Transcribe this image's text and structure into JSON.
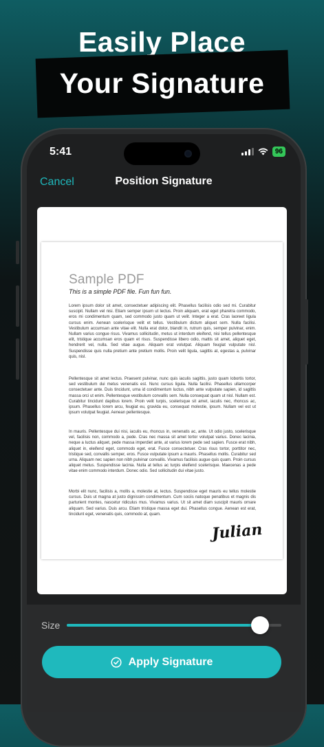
{
  "headline": {
    "line1": "Easily Place",
    "line2": "Your Signature"
  },
  "status_bar": {
    "time": "5:41",
    "battery": "96"
  },
  "nav": {
    "cancel_label": "Cancel",
    "title": "Position Signature"
  },
  "document": {
    "title": "Sample PDF",
    "subtitle": "This is a simple PDF file. Fun fun fun.",
    "paragraphs": [
      "Lorem ipsum dolor sit amet, consectetuer adipiscing elit. Phasellus facilisis odio sed mi. Curabitur suscipit. Nullam vel nisi. Etiam semper ipsum ut lectus. Proin aliquam, erat eget pharetra commodo, eros mi condimentum quam, sed commodo justo quam ut velit. Integer a erat. Cras laoreet ligula cursus enim. Aenean scelerisque velit et tellus. Vestibulum dictum aliquet sem. Nulla facilisi. Vestibulum accumsan ante vitae elit. Nulla erat dolor, blandit in, rutrum quis, semper pulvinar, enim. Nullam varius congue risus. Vivamus sollicitudin, metus ut interdum eleifend, nisi tellus pellentesque elit, tristique accumsan eros quam et risus. Suspendisse libero odio, mattis sit amet, aliquet eget, hendrerit vel, nulla. Sed vitae augue. Aliquam erat volutpat. Aliquam feugiat vulputate nisl. Suspendisse quis nulla pretium ante pretium mollis. Proin velit ligula, sagittis at, egestas a, pulvinar quis, nisl.",
      "Pellentesque sit amet lectus. Praesent pulvinar, nunc quis iaculis sagittis, justo quam lobortis tortor, sed vestibulum dui metus venenatis est. Nunc cursus ligula. Nulla facilisi. Phasellus ullamcorper consectetuer ante. Duis tincidunt, urna id condimentum luctus, nibh ante vulputate sapien, id sagittis massa orci ut enim. Pellentesque vestibulum convallis sem. Nulla consequat quam ut nisl. Nullam est. Curabitur tincidunt dapibus lorem. Proin velit turpis, scelerisque sit amet, iaculis nec, rhoncus ac, ipsum. Phasellus lorem arcu, feugiat eu, gravida eu, consequat molestie, ipsum. Nullam vel est ut ipsum volutpat feugiat. Aenean pellentesque.",
      "In mauris. Pellentesque dui nisi, iaculis eu, rhoncus in, venenatis ac, ante. Ut odio justo, scelerisque vel, facilisis non, commodo a, pede. Cras nec massa sit amet tortor volutpat varius. Donec lacinia, neque a luctus aliquet, pede massa imperdiet ante, at varius lorem pede sed sapien. Fusce erat nibh, aliquet in, eleifend eget, commodo eget, erat. Fusce consectetuer. Cras risus tortor, porttitor nec, tristique sed, convallis semper, eros. Fusce vulputate ipsum a mauris. Phasellus mollis. Curabitur sed urna. Aliquam nec sapien non nibh pulvinar convallis. Vivamus facilisis augue quis quam. Proin cursus aliquet metus. Suspendisse lacinia. Nulla at tellus ac turpis eleifend scelerisque. Maecenas a pede vitae enim commodo interdum. Donec odio. Sed sollicitudin dui vitae justo.",
      "Morbi elit nunc, facilisis a, mollis a, molestie at, lectus. Suspendisse eget mauris eu tellus molestie cursus. Duis ut magna at justo dignissim condimentum. Cum sociis natoque penatibus et magnis dis parturient montes, nascetur ridiculus mus. Vivamus varius. Ut sit amet diam suscipit mauris ornare aliquam. Sed varius. Duis arcu. Etiam tristique massa eget dui. Phasellus congue. Aenean est erat, tincidunt eget, venenatis quis, commodo at, quam."
    ],
    "signature": "Julian"
  },
  "controls": {
    "size_label": "Size",
    "size_value": 0.9,
    "apply_label": "Apply Signature"
  },
  "colors": {
    "accent": "#1fb9bd",
    "battery": "#34c759"
  },
  "icons": {
    "cellular": "cellular-signal-icon",
    "wifi": "wifi-icon",
    "battery": "battery-icon",
    "check": "checkmark-circle-icon"
  }
}
